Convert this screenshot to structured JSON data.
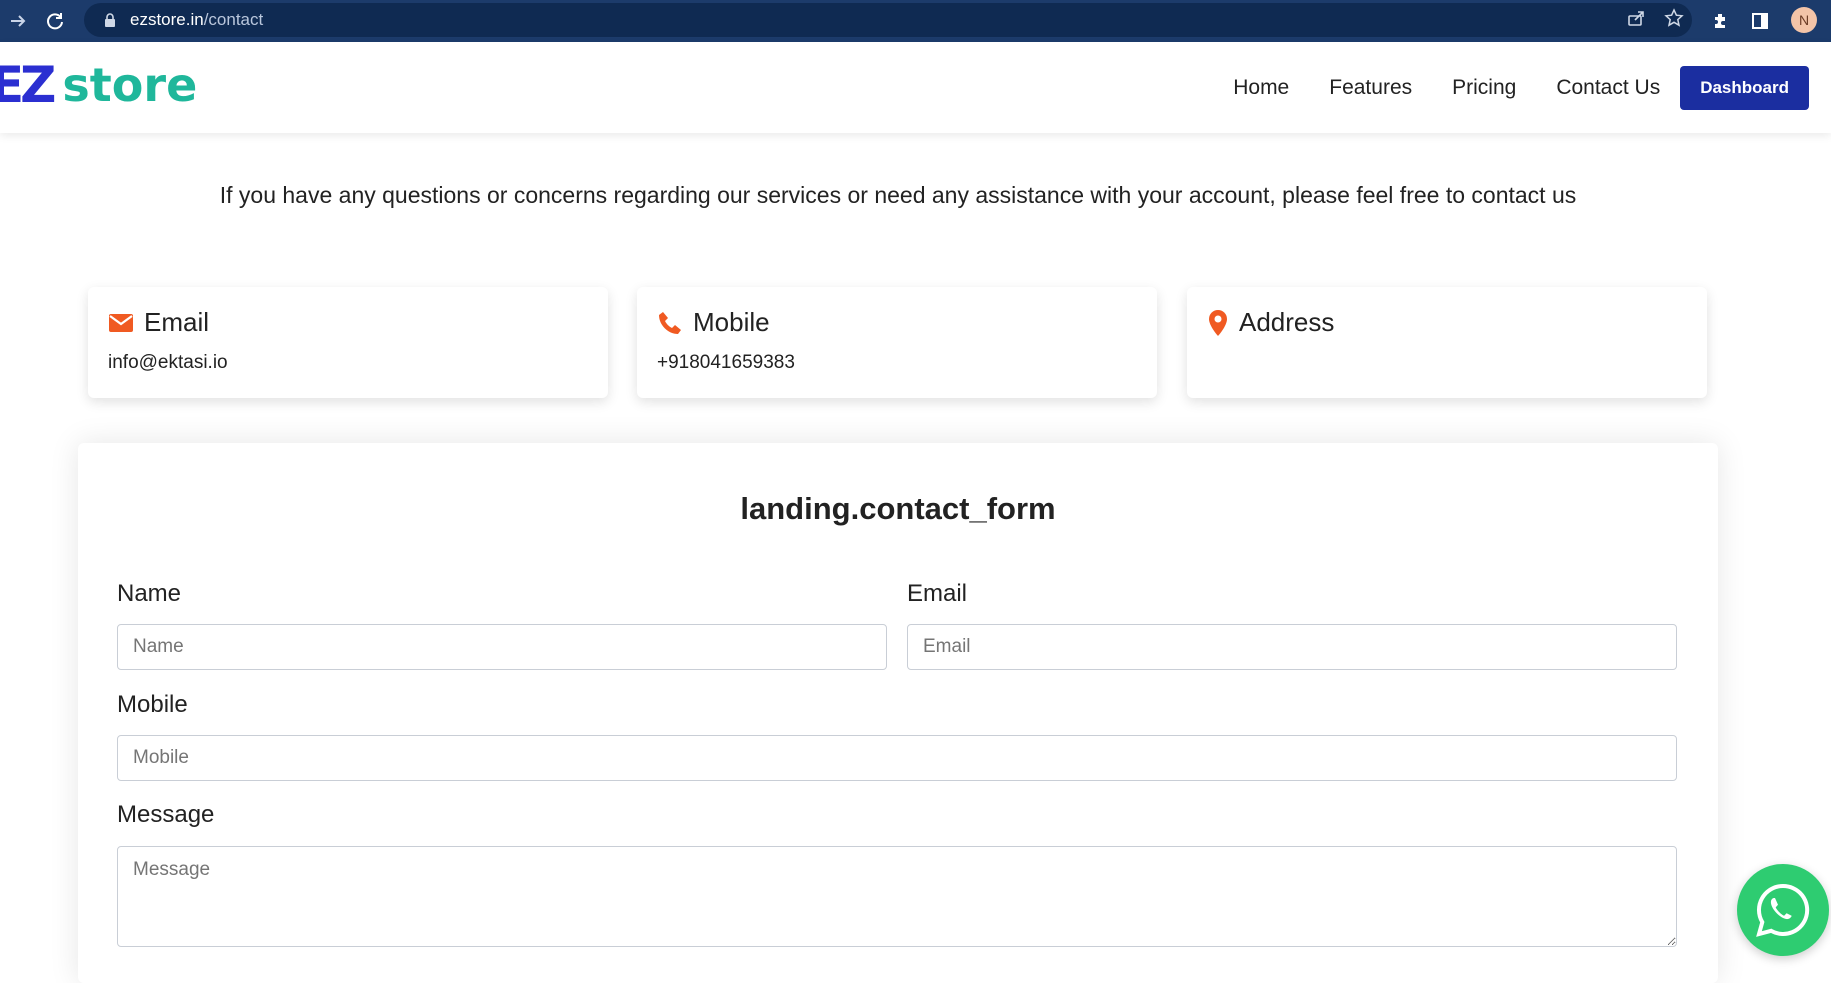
{
  "browser": {
    "url_domain": "ezstore.in",
    "url_path": "/contact",
    "avatar_initial": "N"
  },
  "header": {
    "logo_ez": "EZ",
    "logo_store": "store",
    "nav": [
      "Home",
      "Features",
      "Pricing",
      "Contact Us"
    ],
    "dashboard_label": "Dashboard"
  },
  "intro_text": "If you have any questions or concerns regarding our services or need any assistance with your account, please feel free to contact us",
  "cards": {
    "email": {
      "title": "Email",
      "value": "info@ektasi.io"
    },
    "mobile": {
      "title": "Mobile",
      "value": "+918041659383"
    },
    "address": {
      "title": "Address",
      "value": ""
    }
  },
  "form": {
    "title": "landing.contact_form",
    "name_label": "Name",
    "name_placeholder": "Name",
    "email_label": "Email",
    "email_placeholder": "Email",
    "mobile_label": "Mobile",
    "mobile_placeholder": "Mobile",
    "message_label": "Message",
    "message_placeholder": "Message"
  },
  "colors": {
    "chrome_bg": "#1c3b6b",
    "brand_blue": "#2b2fd1",
    "brand_teal": "#1fb79b",
    "button_bg": "#1b2ea0",
    "icon_orange": "#f05a22",
    "whatsapp_green": "#2ecc71"
  }
}
